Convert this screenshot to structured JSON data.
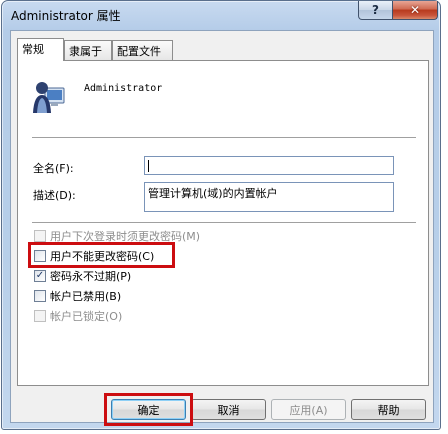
{
  "window": {
    "title": "Administrator 属性"
  },
  "caption_buttons": {
    "help": "?",
    "close": "✕"
  },
  "tabs": [
    {
      "label": "常规"
    },
    {
      "label": "隶属于"
    },
    {
      "label": "配置文件"
    }
  ],
  "user": {
    "name": "Administrator",
    "icon": "user-icon"
  },
  "fields": {
    "full_name": {
      "label": "全名(F):",
      "value": ""
    },
    "description": {
      "label": "描述(D):",
      "value": "管理计算机(域)的内置帐户"
    }
  },
  "checkboxes": [
    {
      "label": "用户下次登录时须更改密码(M)",
      "checked": false,
      "enabled": false
    },
    {
      "label": "用户不能更改密码(C)",
      "checked": false,
      "enabled": true
    },
    {
      "label": "密码永不过期(P)",
      "checked": true,
      "enabled": true
    },
    {
      "label": "帐户已禁用(B)",
      "checked": false,
      "enabled": true
    },
    {
      "label": "帐户已锁定(O)",
      "checked": false,
      "enabled": false
    }
  ],
  "buttons": {
    "ok": "确定",
    "cancel": "取消",
    "apply": "应用(A)",
    "help": "帮助"
  },
  "colors": {
    "highlight": "#cc0d10",
    "title_bar": "#b9d1ea"
  }
}
